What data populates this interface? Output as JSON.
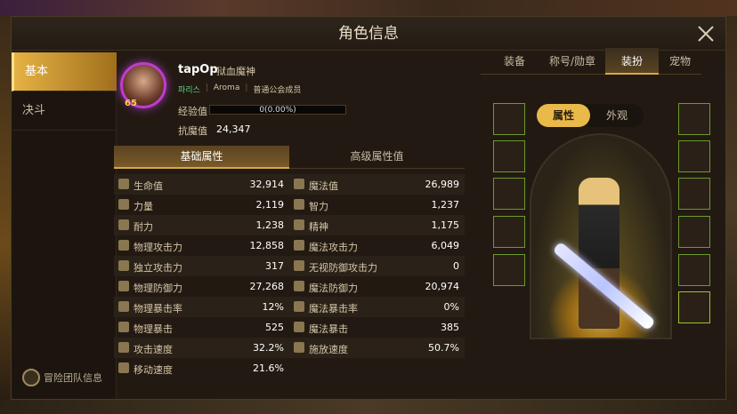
{
  "window": {
    "title": "角色信息"
  },
  "sidebar": {
    "tabs": [
      {
        "label": "基本",
        "active": true
      },
      {
        "label": "决斗",
        "active": false
      }
    ],
    "team_info": "冒险团队信息"
  },
  "profile": {
    "level": "65",
    "name": "tapOp",
    "class": "狱血魔神",
    "server": "파리스",
    "guild": "Aroma",
    "guild_rank": "普通公会成员",
    "exp_label": "经验值",
    "exp_value": "0(0.00%)",
    "exp_fraction": 0.0,
    "anti_magic_label": "抗魔值",
    "anti_magic_value": "24,347"
  },
  "stat_tabs": [
    {
      "label": "基础属性",
      "active": true
    },
    {
      "label": "高级属性值",
      "active": false
    }
  ],
  "stats_left": [
    {
      "icon": "heart-icon",
      "label": "生命值",
      "value": "32,914"
    },
    {
      "icon": "strength-icon",
      "label": "力量",
      "value": "2,119"
    },
    {
      "icon": "stamina-icon",
      "label": "耐力",
      "value": "1,238"
    },
    {
      "icon": "physical-attack-icon",
      "label": "物理攻击力",
      "value": "12,858"
    },
    {
      "icon": "independent-attack-icon",
      "label": "独立攻击力",
      "value": "317"
    },
    {
      "icon": "physical-defense-icon",
      "label": "物理防御力",
      "value": "27,268"
    },
    {
      "icon": "physical-crit-rate-icon",
      "label": "物理暴击率",
      "value": "12%"
    },
    {
      "icon": "physical-crit-icon",
      "label": "物理暴击",
      "value": "525"
    },
    {
      "icon": "attack-speed-icon",
      "label": "攻击速度",
      "value": "32.2%"
    },
    {
      "icon": "move-speed-icon",
      "label": "移动速度",
      "value": "21.6%"
    }
  ],
  "stats_right": [
    {
      "icon": "mana-icon",
      "label": "魔法值",
      "value": "26,989"
    },
    {
      "icon": "intelligence-icon",
      "label": "智力",
      "value": "1,237"
    },
    {
      "icon": "spirit-icon",
      "label": "精神",
      "value": "1,175"
    },
    {
      "icon": "magic-attack-icon",
      "label": "魔法攻击力",
      "value": "6,049"
    },
    {
      "icon": "ignore-defense-icon",
      "label": "无视防御攻击力",
      "value": "0"
    },
    {
      "icon": "magic-defense-icon",
      "label": "魔法防御力",
      "value": "20,974"
    },
    {
      "icon": "magic-crit-rate-icon",
      "label": "魔法暴击率",
      "value": "0%"
    },
    {
      "icon": "magic-crit-icon",
      "label": "魔法暴击",
      "value": "385"
    },
    {
      "icon": "cast-speed-icon",
      "label": "施放速度",
      "value": "50.7%"
    }
  ],
  "right_tabs": [
    {
      "label": "装备",
      "active": false
    },
    {
      "label": "称号/勋章",
      "active": false
    },
    {
      "label": "装扮",
      "active": true
    },
    {
      "label": "宠物",
      "active": false
    }
  ],
  "view_toggle": [
    {
      "label": "属性",
      "active": true
    },
    {
      "label": "外观",
      "active": false
    }
  ],
  "colors": {
    "accent": "#e9b94a",
    "panel": "#221a12",
    "level_ring": "#c03ccf"
  }
}
